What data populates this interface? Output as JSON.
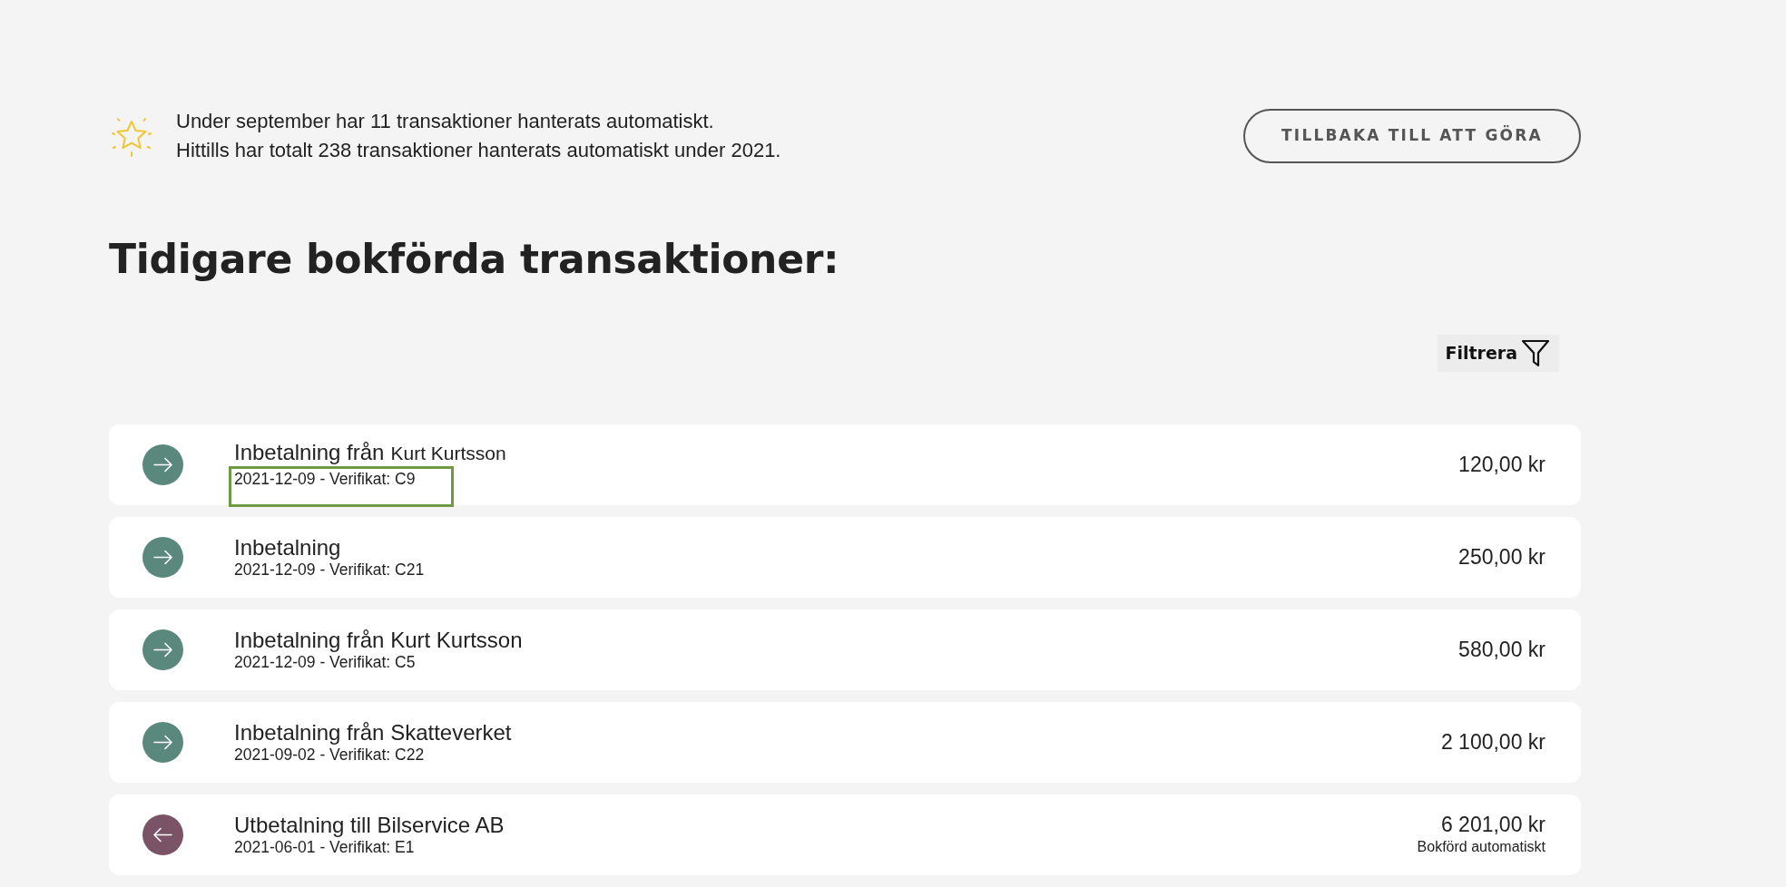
{
  "summary": {
    "lines": [
      "Under september har 11 transaktioner hanterats automatiskt.",
      "Hittills har totalt 238 transaktioner hanterats automatiskt under 2021."
    ]
  },
  "back_button": {
    "label": "TILLBAKA TILL ATT GÖRA"
  },
  "heading": "Tidigare bokförda transaktioner:",
  "filter_button": {
    "label": "Filtrera"
  },
  "transactions": [
    {
      "kind": "incoming",
      "title": "Inbetalning från",
      "counterpart": "Kurt Kurtsson",
      "meta": "2021-12-09 - Verifikat: C9",
      "amount": "120,00 kr",
      "highlighted": true
    },
    {
      "kind": "incoming",
      "title": "Inbetalning",
      "meta": "2021-12-09 - Verifikat: C21",
      "amount": "250,00 kr",
      "highlighted": false
    },
    {
      "kind": "incoming",
      "title": "Inbetalning från Kurt Kurtsson",
      "meta": "2021-12-09 - Verifikat: C5",
      "amount": "580,00 kr",
      "highlighted": false
    },
    {
      "kind": "incoming",
      "title": "Inbetalning från Skatteverket",
      "meta": "2021-09-02 - Verifikat: C22",
      "amount": "2 100,00 kr",
      "highlighted": false
    },
    {
      "kind": "outgoing",
      "title": "Utbetalning till Bilservice AB",
      "meta": "2021-06-01 - Verifikat: E1",
      "amount": "6 201,00 kr",
      "note": "Bokförd automatiskt",
      "highlighted": false
    }
  ]
}
